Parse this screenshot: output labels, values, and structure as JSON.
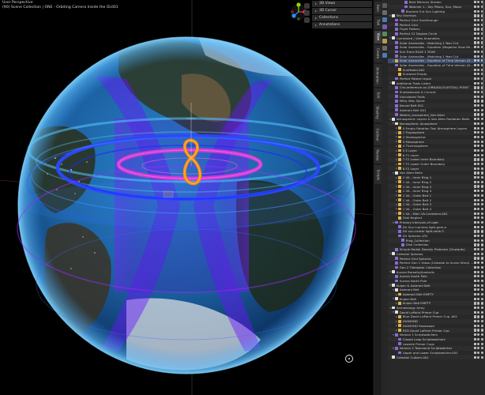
{
  "viewport": {
    "title": "User Perspective",
    "subtitle": "(90) Scene Collection | ONE - Orbiting Camera Inside the OL001",
    "gizmo": {
      "x": "X",
      "y": "Y",
      "z": "Z"
    },
    "panel_rows": [
      "3D Views",
      "3D Cursor",
      "Collections",
      "Annotations"
    ],
    "globe_colors": {
      "ocean": "#1d6fb8",
      "rings": "#2f5bff",
      "magenta": "#d63ad6",
      "orange": "#ff8a00",
      "violet": "#9a2cff"
    }
  },
  "tabs": {
    "main": [
      "Item",
      "Tool",
      "View",
      "Create",
      "Animation",
      "Edit",
      "Shading",
      "Outliner",
      "Render",
      "Scripts"
    ],
    "active": "View"
  },
  "outliner": {
    "rows": [
      {
        "depth": 4,
        "label": "Best Memory Stream",
        "icon": "#8a6cd6",
        "arrow": "",
        "cls": ""
      },
      {
        "depth": 4,
        "label": "Watcher 1 - Sky Pillars, Sun, Moon",
        "icon": "#8a6cd6",
        "arrow": "",
        "cls": "alt"
      },
      {
        "depth": 3,
        "label": "Blocked Out Sun Lighting",
        "icon": "#8a6cd6",
        "arrow": "",
        "cls": ""
      },
      {
        "depth": 0,
        "label": "Sky Overlays",
        "icon": "#e0e0e0",
        "arrow": "v",
        "cls": "alt"
      },
      {
        "depth": 1,
        "label": "Perfect Grid Overthrough",
        "icon": "#8a6cd6",
        "arrow": "",
        "cls": ""
      },
      {
        "depth": 1,
        "label": "Perfect Grid",
        "icon": "#8a6cd6",
        "arrow": "",
        "cls": "alt"
      },
      {
        "depth": 1,
        "label": "Flight Pattern",
        "icon": "#8a6cd6",
        "arrow": "",
        "cls": ""
      },
      {
        "depth": 1,
        "label": "Perfect 12 Degree Circle",
        "icon": "#8a6cd6",
        "arrow": "",
        "cls": "alt"
      },
      {
        "depth": 0,
        "label": "Correlated | View Anomalies",
        "icon": "#e0e0e0",
        "arrow": "v",
        "cls": ""
      },
      {
        "depth": 1,
        "label": "Solar Anomalies - Matching 1 Year Cut",
        "icon": "#8a6cd6",
        "arrow": "",
        "cls": "alt"
      },
      {
        "depth": 1,
        "label": "Solar Anomalies - Equation (Negative Slow Window)",
        "icon": "#8a6cd6",
        "arrow": "",
        "cls": ""
      },
      {
        "depth": 1,
        "label": "Sun Trace BLUE 1 YEAR",
        "icon": "#8a6cd6",
        "arrow": "",
        "cls": "alt"
      },
      {
        "depth": 1,
        "label": "Solar Anomalies - Matching 1 Year Cut",
        "icon": "#8a6cd6",
        "arrow": "",
        "cls": ""
      },
      {
        "depth": 1,
        "label": "Solar Anomalies - Equation of Time Version (Daily)",
        "icon": "#e0b04a",
        "arrow": ">",
        "cls": "sel"
      },
      {
        "depth": 1,
        "label": "Solar Anomalies - Equation of Time Version (Disappe...",
        "icon": "#8a6cd6",
        "arrow": "",
        "cls": ""
      },
      {
        "depth": 2,
        "label": "SunModel.002",
        "icon": "#e0b04a",
        "arrow": "",
        "cls": "alt"
      },
      {
        "depth": 2,
        "label": "Sunward Empty",
        "icon": "#e0b04a",
        "arrow": "",
        "cls": ""
      },
      {
        "depth": 1,
        "label": "Perfect Pattern Input",
        "icon": "#8a6cd6",
        "arrow": "",
        "cls": "alt"
      },
      {
        "depth": 0,
        "label": "Additional Tools Listen",
        "icon": "#e0e0e0",
        "arrow": "v",
        "cls": ""
      },
      {
        "depth": 1,
        "label": "Circumference on JORNAD(CELESTIAL) POINT",
        "icon": "#8a6cd6",
        "arrow": "",
        "cls": "alt"
      },
      {
        "depth": 1,
        "label": "Shadowlands & Current",
        "icon": "#8a6cd6",
        "arrow": "",
        "cls": ""
      },
      {
        "depth": 1,
        "label": "Unicolored Trails",
        "icon": "#8a6cd6",
        "arrow": "",
        "cls": "alt"
      },
      {
        "depth": 1,
        "label": "Milky Way Spiral",
        "icon": "#8a6cd6",
        "arrow": "",
        "cls": ""
      },
      {
        "depth": 1,
        "label": "Neural Belt 001",
        "icon": "#8a6cd6",
        "arrow": "",
        "cls": "alt"
      },
      {
        "depth": 1,
        "label": "Asteroid Belt 001",
        "icon": "#8a6cd6",
        "arrow": "",
        "cls": ""
      },
      {
        "depth": 1,
        "label": "Waters_Ionosphere_Van Allen",
        "icon": "#8a6cd6",
        "arrow": "",
        "cls": "alt"
      },
      {
        "depth": 0,
        "label": "Atmospheric Layers & Van Allen Radiation Belts",
        "icon": "#e0e0e0",
        "arrow": "v",
        "cls": ""
      },
      {
        "depth": 1,
        "label": "Atmosphere, Ionosphere",
        "icon": "#e0e0e0",
        "arrow": "v",
        "cls": "alt"
      },
      {
        "depth": 2,
        "label": "0 Empty Rotation Tool Atmosphere Layers",
        "icon": "#e0b04a",
        "arrow": ">",
        "cls": ""
      },
      {
        "depth": 2,
        "label": "1 Troposphere",
        "icon": "#e0b04a",
        "arrow": ">",
        "cls": "alt"
      },
      {
        "depth": 2,
        "label": "2 Stratosphere",
        "icon": "#e0b04a",
        "arrow": ">",
        "cls": ""
      },
      {
        "depth": 2,
        "label": "3 Mesosphere",
        "icon": "#e0b04a",
        "arrow": ">",
        "cls": "alt"
      },
      {
        "depth": 2,
        "label": "4 Thermosphere",
        "icon": "#e0b04a",
        "arrow": ">",
        "cls": ""
      },
      {
        "depth": 2,
        "label": "5 E Layer",
        "icon": "#e0b04a",
        "arrow": ">",
        "cls": "alt"
      },
      {
        "depth": 2,
        "label": "6 F1 Layer",
        "icon": "#e0b04a",
        "arrow": ">",
        "cls": ""
      },
      {
        "depth": 2,
        "label": "7 F2 Lower Inner Boundary",
        "icon": "#e0b04a",
        "arrow": ">",
        "cls": "alt"
      },
      {
        "depth": 2,
        "label": "7 F2 Lower Outer Boundary",
        "icon": "#e0b04a",
        "arrow": ">",
        "cls": ""
      },
      {
        "depth": 2,
        "label": "8 F2 Layer",
        "icon": "#e0b04a",
        "arrow": ">",
        "cls": "alt"
      },
      {
        "depth": 1,
        "label": "Van Allen Belts",
        "icon": "#e0e0e0",
        "arrow": "v",
        "cls": ""
      },
      {
        "depth": 2,
        "label": "1 VA - Inner Ring 1",
        "icon": "#e0b04a",
        "arrow": ">",
        "cls": "alt"
      },
      {
        "depth": 2,
        "label": "1 VA - Inner Ring 2",
        "icon": "#e0b04a",
        "arrow": ">",
        "cls": ""
      },
      {
        "depth": 2,
        "label": "1 VA - Inner Ring 3",
        "icon": "#e0b04a",
        "arrow": ">",
        "cls": "alt"
      },
      {
        "depth": 2,
        "label": "1 VA - Inner Ring 4",
        "icon": "#e0b04a",
        "arrow": ">",
        "cls": ""
      },
      {
        "depth": 2,
        "label": "1 VA - Outer Belt 1",
        "icon": "#e0b04a",
        "arrow": ">",
        "cls": "alt"
      },
      {
        "depth": 2,
        "label": "1 VA - Outer Belt 2",
        "icon": "#e0b04a",
        "arrow": ">",
        "cls": ""
      },
      {
        "depth": 2,
        "label": "1 VA - Outer Belt 3",
        "icon": "#e0b04a",
        "arrow": ">",
        "cls": "alt"
      },
      {
        "depth": 2,
        "label": "1 VA - Outer Belt 4",
        "icon": "#e0b04a",
        "arrow": ">",
        "cls": ""
      },
      {
        "depth": 2,
        "label": "1 VA - Main VA-Container.001",
        "icon": "#e0b04a",
        "arrow": ">",
        "cls": "alt"
      },
      {
        "depth": 2,
        "label": "Disk Neglect",
        "icon": "#e0b04a",
        "arrow": "",
        "cls": ""
      },
      {
        "depth": 1,
        "label": "Primary Intervals of Light",
        "icon": "#8a6cd6",
        "arrow": "v",
        "cls": "alt"
      },
      {
        "depth": 2,
        "label": "Dir Sun Lumines light.gem.a",
        "icon": "#8a6cd6",
        "arrow": "",
        "cls": ""
      },
      {
        "depth": 2,
        "label": "Dir sun-center light.stele.5",
        "icon": "#8a6cd6",
        "arrow": "",
        "cls": "alt"
      },
      {
        "depth": 2,
        "label": "Dir Spheres LFD",
        "icon": "#8a6cd6",
        "arrow": "",
        "cls": ""
      },
      {
        "depth": 3,
        "label": "Ring_Collection",
        "icon": "#8a6cd6",
        "arrow": "",
        "cls": "alt"
      },
      {
        "depth": 3,
        "label": "Disk Collection",
        "icon": "#8a6cd6",
        "arrow": "",
        "cls": ""
      },
      {
        "depth": 1,
        "label": "Simple Radial Density Protector (Onwards)",
        "icon": "#8a6cd6",
        "arrow": "",
        "cls": "alt"
      },
      {
        "depth": 0,
        "label": "Celestial Spheres",
        "icon": "#e0e0e0",
        "arrow": "v",
        "cls": ""
      },
      {
        "depth": 1,
        "label": "Perfect Grid Spheres",
        "icon": "#8a6cd6",
        "arrow": "",
        "cls": "alt"
      },
      {
        "depth": 1,
        "label": "Perfect Gen 1 Glass (Celestial to Scene Wind) (yard)",
        "icon": "#8a6cd6",
        "arrow": "",
        "cls": ""
      },
      {
        "depth": 1,
        "label": "Gen 2 Tidewater Collection",
        "icon": "#8a6cd6",
        "arrow": "",
        "cls": "alt"
      },
      {
        "depth": 0,
        "label": "Aurora Borealis/Australis",
        "icon": "#e0e0e0",
        "arrow": "v",
        "cls": ""
      },
      {
        "depth": 1,
        "label": "Aurora South Pole",
        "icon": "#8a6cd6",
        "arrow": "",
        "cls": "alt"
      },
      {
        "depth": 1,
        "label": "Aurora North Pole",
        "icon": "#8a6cd6",
        "arrow": "",
        "cls": ""
      },
      {
        "depth": 0,
        "label": "Kuiper & Asteroid Belt",
        "icon": "#e0e0e0",
        "arrow": "v",
        "cls": "alt"
      },
      {
        "depth": 1,
        "label": "Asteroid Belt",
        "icon": "#e0e0e0",
        "arrow": "v",
        "cls": ""
      },
      {
        "depth": 2,
        "label": "Asteroid Belt EMPTY",
        "icon": "#e0b04a",
        "arrow": ">",
        "cls": "alt"
      },
      {
        "depth": 1,
        "label": "Kuiper Belt",
        "icon": "#e0e0e0",
        "arrow": "v",
        "cls": ""
      },
      {
        "depth": 2,
        "label": "Kuiper Belt EMPTY",
        "icon": "#e0b04a",
        "arrow": ">",
        "cls": "alt"
      },
      {
        "depth": 0,
        "label": "Archaeology Array",
        "icon": "#e0e0e0",
        "arrow": "v",
        "cls": ""
      },
      {
        "depth": 1,
        "label": "David LaPoint Primer Cup",
        "icon": "#e0e0e0",
        "arrow": "v",
        "cls": "alt"
      },
      {
        "depth": 2,
        "label": "Blue David LaPoint Primer Cup .001",
        "icon": "#e0b04a",
        "arrow": ">",
        "cls": ""
      },
      {
        "depth": 2,
        "label": "DIAMOND",
        "icon": "#e0b04a",
        "arrow": ">",
        "cls": "alt"
      },
      {
        "depth": 2,
        "label": "DIAMOND Rosewood",
        "icon": "#e0b04a",
        "arrow": ">",
        "cls": ""
      },
      {
        "depth": 2,
        "label": "RED David LaPoint Primer Cup",
        "icon": "#e0b04a",
        "arrow": ">",
        "cls": "alt"
      },
      {
        "depth": 1,
        "label": "Version 1 Scriptwatchers",
        "icon": "#8a6cd6",
        "arrow": "v",
        "cls": ""
      },
      {
        "depth": 2,
        "label": "Closed Loop Scriptwatchers",
        "icon": "#8a6cd6",
        "arrow": "",
        "cls": "alt"
      },
      {
        "depth": 2,
        "label": "Lowerle Primer Cups",
        "icon": "#8a6cd6",
        "arrow": "",
        "cls": ""
      },
      {
        "depth": 1,
        "label": "Version 2 Townsend Scriptwatcher",
        "icon": "#8a6cd6",
        "arrow": "v",
        "cls": "alt"
      },
      {
        "depth": 2,
        "label": "Upper and Lower Scriptwatcher.001",
        "icon": "#8a6cd6",
        "arrow": "",
        "cls": ""
      },
      {
        "depth": 0,
        "label": "Celestial Cutters.001",
        "icon": "#e0e0e0",
        "arrow": "",
        "cls": "alt"
      }
    ]
  }
}
